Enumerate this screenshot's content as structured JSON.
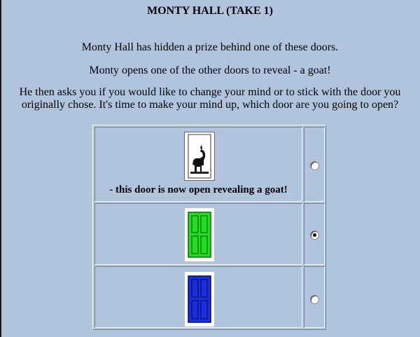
{
  "page": {
    "title": "MONTY HALL (TAKE 1)",
    "intro_line1": "Monty Hall has hidden a prize behind one of these doors.",
    "intro_line2": "Monty opens one of the other doors to reveal - a goat!",
    "intro_line3": "He then asks you if you would like to change your mind or to stick with the door you originally chose. It's time to make your mind up, which door are you going to open?"
  },
  "doors": [
    {
      "name": "white-open-door",
      "caption": "- this door is now open revealing a goat!",
      "color": "#ffffff",
      "selected": false,
      "icon": "goat-icon"
    },
    {
      "name": "green-door",
      "caption": "",
      "color": "#22dd22",
      "selected": true,
      "icon": "door-icon"
    },
    {
      "name": "blue-door",
      "caption": "",
      "color": "#1a2ee0",
      "selected": false,
      "icon": "door-icon"
    }
  ]
}
